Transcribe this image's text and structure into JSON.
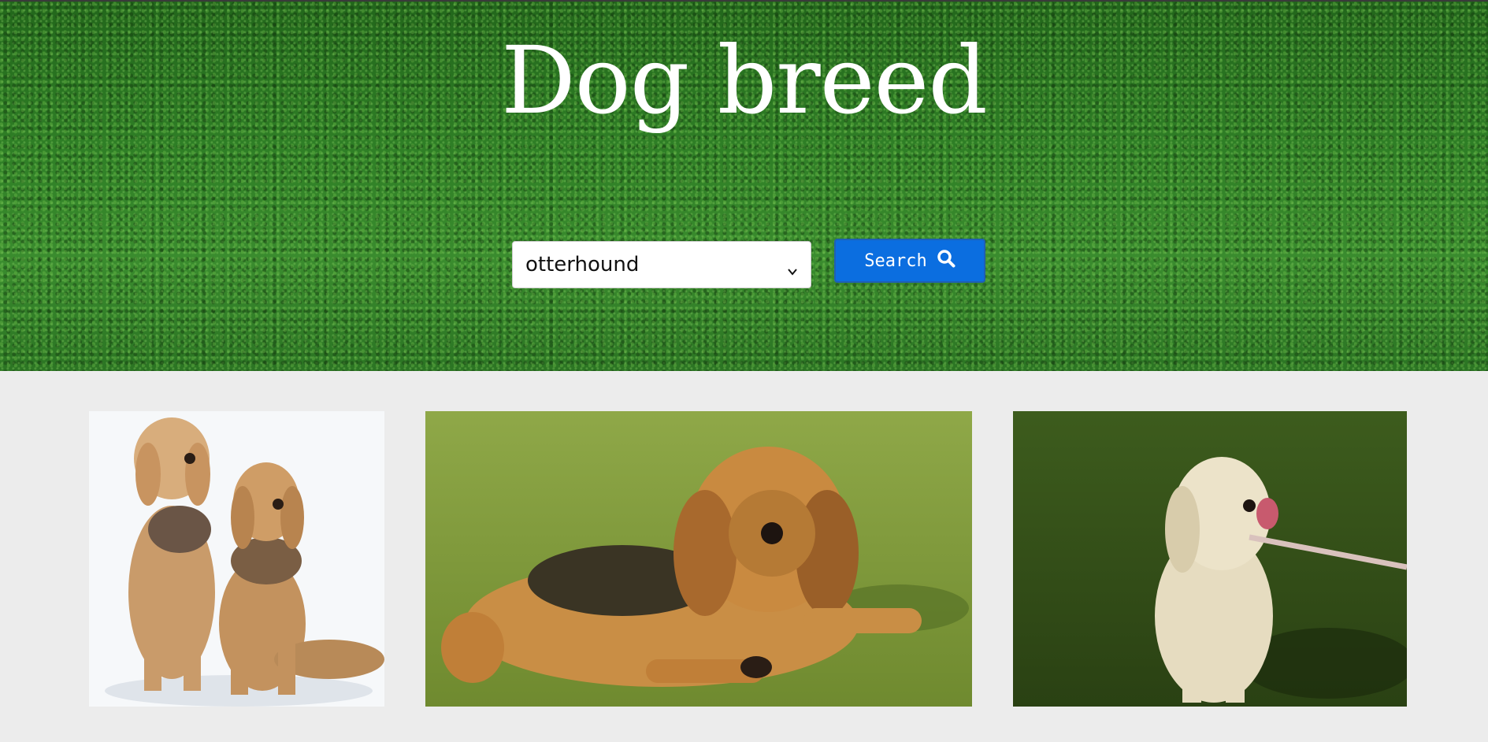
{
  "hero": {
    "title": "Dog breed"
  },
  "search": {
    "selected_breed": "otterhound",
    "button_label": "Search",
    "button_icon": "search-icon"
  },
  "gallery": {
    "photos": [
      {
        "subject": "two otterhounds sitting"
      },
      {
        "subject": "otterhound lying on grass"
      },
      {
        "subject": "cream otterhound sitting on leash"
      }
    ]
  },
  "colors": {
    "accent": "#0b6ee0",
    "page_background": "#ececec",
    "hero_green": "#2f7a25"
  }
}
